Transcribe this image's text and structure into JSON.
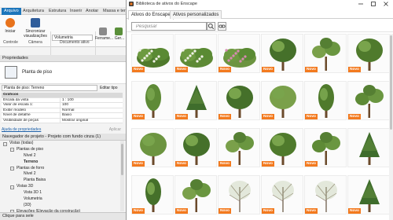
{
  "revit": {
    "quick_access": "",
    "tabs": [
      "Arquivo",
      "Arquitetura",
      "Estrutura",
      "Inserir",
      "Anotar",
      "Massa e terreno"
    ],
    "ribbon": {
      "start_label": "Iniciar",
      "sync_label": "Sincronizar visualizações",
      "view_select": "Vetuaria",
      "view_select_value": "Volumetria",
      "tools_label": "Ferrame...",
      "extra_label": "Ger...",
      "group_controle": "Controle",
      "group_camera": "Câmera",
      "group_doc": "Documento ativo"
    },
    "properties": {
      "header": "Propriedades",
      "type_name": "Planta de piso",
      "selector": "Planta de piso: Terreno",
      "edit_type": "Editar tipo",
      "rows": [
        {
          "k": "Gráficos",
          "v": "",
          "section": true
        },
        {
          "k": "Escala da vista",
          "v": "1 : 100"
        },
        {
          "k": "Valor de escala    1:",
          "v": "100"
        },
        {
          "k": "Exibir modelo",
          "v": "Normal"
        },
        {
          "k": "Nível de detalhe",
          "v": "Baixo"
        },
        {
          "k": "Visibilidade de peças",
          "v": "Mostrar original"
        }
      ],
      "help_link": "Ajuda de propriedades",
      "apply": "Aplicar"
    },
    "browser": {
      "header": "Navegador de projeto - Projeto com fundo cinza (1)",
      "nodes": [
        {
          "label": "Vistas (todas)",
          "level": 0,
          "toggle": "−"
        },
        {
          "label": "Plantas de piso",
          "level": 1,
          "toggle": "−"
        },
        {
          "label": "Nível 2",
          "level": 2,
          "toggle": ""
        },
        {
          "label": "Terreno",
          "level": 2,
          "toggle": "",
          "bold": true
        },
        {
          "label": "Plantas de forro",
          "level": 1,
          "toggle": "−"
        },
        {
          "label": "Nível 2",
          "level": 2,
          "toggle": ""
        },
        {
          "label": "Planta Baixa",
          "level": 2,
          "toggle": ""
        },
        {
          "label": "Vistas 3D",
          "level": 1,
          "toggle": "−"
        },
        {
          "label": "Vista 3D 1",
          "level": 2,
          "toggle": ""
        },
        {
          "label": "Volumetria",
          "level": 2,
          "toggle": ""
        },
        {
          "label": "{3D}",
          "level": 2,
          "toggle": ""
        },
        {
          "label": "Elevações (Elevação da construção)",
          "level": 1,
          "toggle": "−"
        },
        {
          "label": "Norte",
          "level": 2,
          "toggle": ""
        }
      ]
    },
    "status": "Clique para sele"
  },
  "library": {
    "title": "Biblioteca de ativos do Enscape",
    "tabs": [
      "Ativos do Enscape",
      "Ativos personalizados"
    ],
    "active_tab": 0,
    "search_placeholder": "Pesquisar",
    "badge_label": "Novo",
    "accent": "#f37a1f",
    "items": [
      {
        "kind": "shrub-flower",
        "badge": true
      },
      {
        "kind": "shrub-flower",
        "badge": true
      },
      {
        "kind": "shrub-pink",
        "badge": true
      },
      {
        "kind": "tree-round",
        "badge": true
      },
      {
        "kind": "tree-sparse",
        "badge": true
      },
      {
        "kind": "tree-round",
        "badge": true
      },
      {
        "kind": "tree-tall",
        "badge": true
      },
      {
        "kind": "tree-conifer",
        "badge": true
      },
      {
        "kind": "tree-round",
        "badge": true
      },
      {
        "kind": "tree-round",
        "badge": true
      },
      {
        "kind": "tree-tall",
        "badge": true
      },
      {
        "kind": "tree-sparse",
        "badge": true
      },
      {
        "kind": "tree-round",
        "badge": true
      },
      {
        "kind": "tree-round",
        "badge": true
      },
      {
        "kind": "tree-sparse",
        "badge": true
      },
      {
        "kind": "tree-round",
        "badge": true
      },
      {
        "kind": "tree-sparse",
        "badge": true
      },
      {
        "kind": "tree-conifer",
        "badge": false
      },
      {
        "kind": "tree-tall",
        "badge": true
      },
      {
        "kind": "tree-sparse",
        "badge": true
      },
      {
        "kind": "tree-bare",
        "badge": true
      },
      {
        "kind": "tree-bare",
        "badge": true
      },
      {
        "kind": "tree-bare",
        "badge": true
      },
      {
        "kind": "tree-conifer",
        "badge": true
      }
    ]
  }
}
